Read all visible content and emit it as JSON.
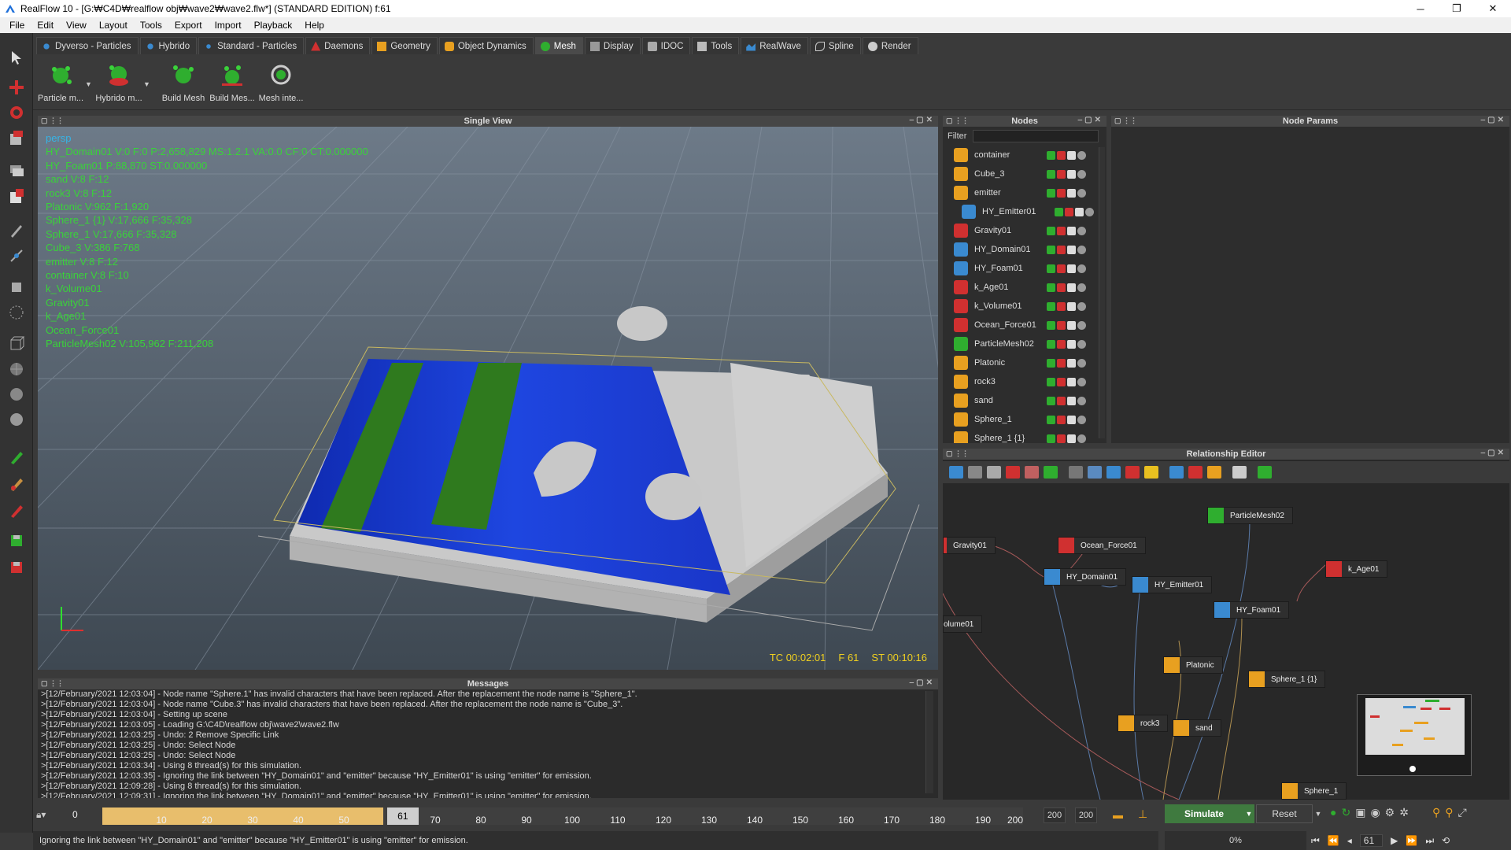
{
  "window": {
    "title": "RealFlow 10 - [G:₩C4D₩realflow obj₩wave2₩wave2.flw*] (STANDARD EDITION) f:61",
    "controls": {
      "minimize": "─",
      "maximize": "❐",
      "close": "✕"
    }
  },
  "menu": [
    "File",
    "Edit",
    "View",
    "Layout",
    "Tools",
    "Export",
    "Import",
    "Playback",
    "Help"
  ],
  "tabs": [
    {
      "label": "Dyverso - Particles",
      "active": false
    },
    {
      "label": "Hybrido",
      "active": false
    },
    {
      "label": "Standard - Particles",
      "active": false
    },
    {
      "label": "Daemons",
      "active": false
    },
    {
      "label": "Geometry",
      "active": false
    },
    {
      "label": "Object Dynamics",
      "active": false
    },
    {
      "label": "Mesh",
      "active": true
    },
    {
      "label": "Display",
      "active": false
    },
    {
      "label": "IDOC",
      "active": false
    },
    {
      "label": "Tools",
      "active": false
    },
    {
      "label": "RealWave",
      "active": false
    },
    {
      "label": "Spline",
      "active": false
    },
    {
      "label": "Render",
      "active": false
    }
  ],
  "shelf": [
    {
      "label": "Particle m...",
      "icon": "particle-mesh-icon"
    },
    {
      "label": "Hybrido m...",
      "icon": "hybrido-mesh-icon"
    },
    {
      "label": "Build Mesh",
      "icon": "build-mesh-icon"
    },
    {
      "label": "Build Mes...",
      "icon": "build-mesh-sequence-icon"
    },
    {
      "label": "Mesh inte...",
      "icon": "mesh-interpolation-icon"
    }
  ],
  "viewport": {
    "title": "Single View",
    "camera": "persp",
    "info_lines": [
      "HY_Domain01 V:0 F:0 P:2,658,829 MS:1.2.1 VA:0.0 CF:0 CT:0.000000",
      "HY_Foam01 P:88,870 ST:0.000000",
      "sand V:8 F:12",
      "rock3 V:8 F:12",
      "Platonic V:962 F:1,920",
      "Sphere_1 {1} V:17,666 F:35,328",
      "Sphere_1 V:17,666 F:35,328",
      "Cube_3 V:386 F:768",
      "emitter V:8 F:12",
      "container V:8 F:10",
      "k_Volume01",
      "Gravity01",
      "k_Age01",
      "Ocean_Force01",
      "ParticleMesh02 V:105,962 F:211,208"
    ],
    "tc": "TC 00:02:01",
    "frame": "F 61",
    "st": "ST 00:10:16"
  },
  "messages": {
    "title": "Messages",
    "lines": [
      ">[12/February/2021 12:03:04] - Node name \"Sphere.1\" has invalid characters that have been replaced. After the replacement the node name is \"Sphere_1\".",
      ">[12/February/2021 12:03:04] - Node name \"Cube.3\" has invalid characters that have been replaced. After the replacement the node name is \"Cube_3\".",
      ">[12/February/2021 12:03:04] - Setting up scene",
      ">[12/February/2021 12:03:05] - Loading G:\\C4D\\realflow obj\\wave2\\wave2.flw",
      ">[12/February/2021 12:03:25] - Undo: 2 Remove Specific Link",
      ">[12/February/2021 12:03:25] - Undo: Select Node",
      ">[12/February/2021 12:03:25] - Undo: Select Node",
      ">[12/February/2021 12:03:34] - Using 8 thread(s) for this simulation.",
      ">[12/February/2021 12:03:35] - Ignoring the link between \"HY_Domain01\" and \"emitter\" because \"HY_Emitter01\" is using \"emitter\" for emission.",
      ">[12/February/2021 12:09:28] - Using 8 thread(s) for this simulation.",
      ">[12/February/2021 12:09:31] - Ignoring the link between \"HY_Domain01\" and \"emitter\" because \"HY_Emitter01\" is using \"emitter\" for emission."
    ]
  },
  "timeline": {
    "start": "0",
    "ticks": [
      "10",
      "20",
      "30",
      "40",
      "50",
      "70",
      "80",
      "90",
      "100",
      "110",
      "120",
      "130",
      "140",
      "150",
      "160",
      "170",
      "180",
      "190",
      "200"
    ],
    "current": "61",
    "end_a": "200",
    "end_b": "200",
    "current_fraction": 0.305
  },
  "sim": {
    "simulate": "Simulate",
    "reset": "Reset",
    "progress": "0%",
    "frame": "61"
  },
  "status": "Ignoring the link between \"HY_Domain01\" and \"emitter\" because \"HY_Emitter01\" is using \"emitter\" for emission.",
  "nodes": {
    "title": "Nodes",
    "filter_label": "Filter",
    "items": [
      {
        "name": "container",
        "icon": "cube-icon",
        "color": "#e8a020"
      },
      {
        "name": "Cube_3",
        "icon": "cube-icon",
        "color": "#e8a020"
      },
      {
        "name": "emitter",
        "icon": "cube-icon",
        "color": "#e8a020"
      },
      {
        "name": "HY_Emitter01",
        "icon": "emitter-icon",
        "color": "#3a8ad0"
      },
      {
        "name": "Gravity01",
        "icon": "gravity-icon",
        "color": "#d03030"
      },
      {
        "name": "HY_Domain01",
        "icon": "domain-icon",
        "color": "#3a8ad0"
      },
      {
        "name": "HY_Foam01",
        "icon": "foam-icon",
        "color": "#3a8ad0"
      },
      {
        "name": "k_Age01",
        "icon": "age-daemon-icon",
        "color": "#d03030"
      },
      {
        "name": "k_Volume01",
        "icon": "volume-daemon-icon",
        "color": "#d03030"
      },
      {
        "name": "Ocean_Force01",
        "icon": "ocean-force-icon",
        "color": "#d03030"
      },
      {
        "name": "ParticleMesh02",
        "icon": "particle-mesh-icon",
        "color": "#2fae2f"
      },
      {
        "name": "Platonic",
        "icon": "cube-icon",
        "color": "#e8a020"
      },
      {
        "name": "rock3",
        "icon": "cube-icon",
        "color": "#e8a020"
      },
      {
        "name": "sand",
        "icon": "cube-icon",
        "color": "#e8a020"
      },
      {
        "name": "Sphere_1",
        "icon": "cube-icon",
        "color": "#e8a020"
      },
      {
        "name": "Sphere_1 {1}",
        "icon": "cube-icon",
        "color": "#e8a020"
      }
    ]
  },
  "params": {
    "title": "Node Params"
  },
  "relationship": {
    "title": "Relationship Editor",
    "nodes": [
      {
        "name": "ParticleMesh02",
        "color": "#2fae2f"
      },
      {
        "name": "Gravity01",
        "color": "#d03030"
      },
      {
        "name": "Ocean_Force01",
        "color": "#d03030"
      },
      {
        "name": "HY_Domain01",
        "color": "#3a8ad0"
      },
      {
        "name": "HY_Emitter01",
        "color": "#3a8ad0"
      },
      {
        "name": "k_Age01",
        "color": "#d03030"
      },
      {
        "name": "HY_Foam01",
        "color": "#3a8ad0"
      },
      {
        "name": "olume01",
        "color": "#d03030"
      },
      {
        "name": "Platonic",
        "color": "#e8a020"
      },
      {
        "name": "Sphere_1 {1}",
        "color": "#e8a020"
      },
      {
        "name": "rock3",
        "color": "#e8a020"
      },
      {
        "name": "sand",
        "color": "#e8a020"
      },
      {
        "name": "Sphere_1",
        "color": "#e8a020"
      }
    ]
  },
  "colors": {
    "accent_green": "#3ad23a",
    "fluid_blue": "#1a3ed8",
    "foam_green": "#2f7a1e",
    "timecode": "#f0d020",
    "timeline_fill": "#e8be6c"
  }
}
